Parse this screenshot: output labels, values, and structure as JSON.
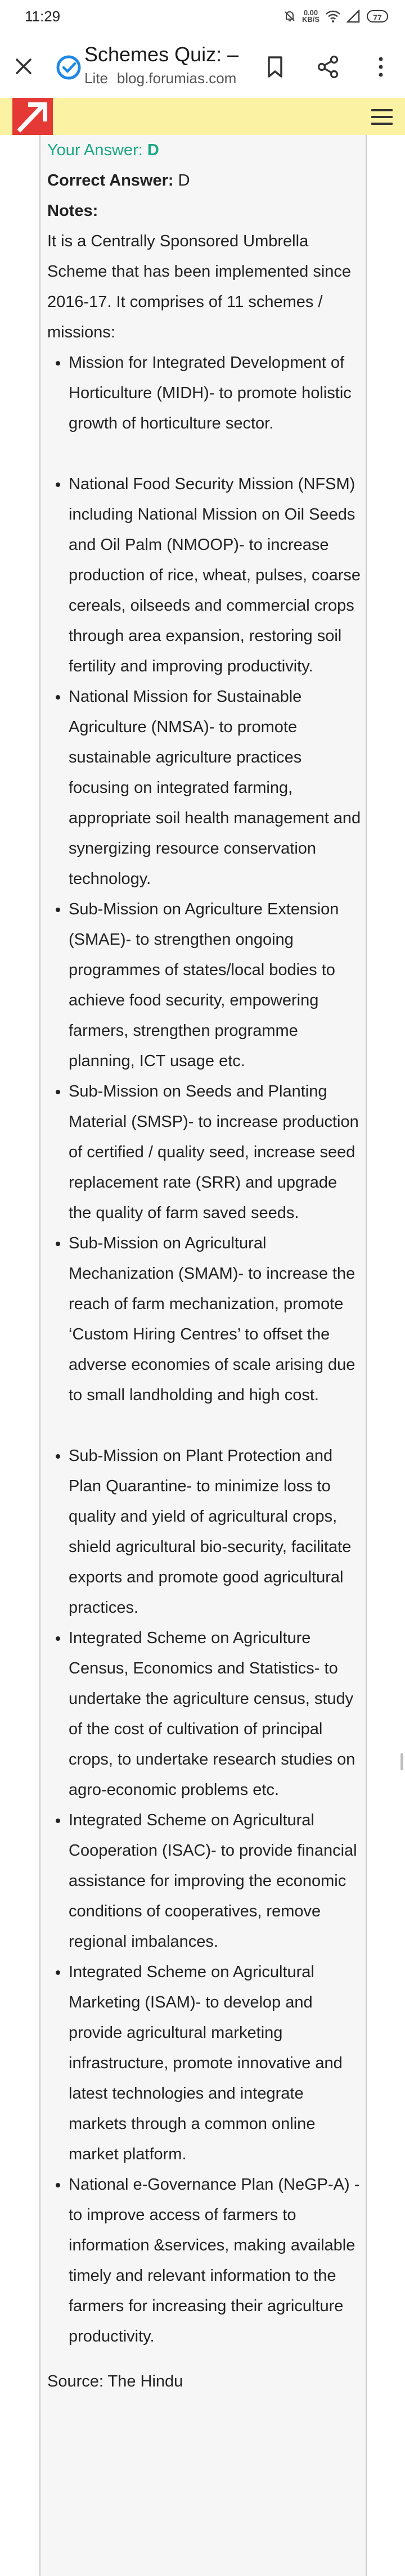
{
  "status_bar": {
    "time": "11:29",
    "speed_value": "0.00",
    "speed_unit": "KB/S",
    "battery": "77"
  },
  "toolbar": {
    "page_title": "Schemes Quiz: – ...",
    "lite_label": "Lite",
    "domain": "blog.forumias.com"
  },
  "colors": {
    "header_bg": "#fbf3a3",
    "logo_bg": "#e53935",
    "answer_green": "#1aa882",
    "card_bg": "#f6f6f6"
  },
  "quiz": {
    "your_answer_label": "Your Answer:",
    "your_answer_value": "D",
    "correct_answer_label": "Correct Answer:",
    "correct_answer_value": "D",
    "notes_label": "Notes:",
    "intro": "It is a Centrally Sponsored Umbrella Scheme that has been implemented since 2016-17. It comprises of 11 schemes / missions:",
    "missions": [
      "Mission for Integrated Development of Horticulture (MIDH)- to promote holistic growth of horticulture sector.",
      "National Food Security Mission (NFSM) including National Mission on Oil Seeds and Oil Palm (NMOOP)- to increase production of rice, wheat, pulses, coarse cereals, oilseeds and commercial crops through area expansion, restoring soil fertility and improving productivity.",
      "National Mission for Sustainable Agriculture (NMSA)- to promote sustainable agriculture practices focusing on integrated farming, appropriate soil health management and synergizing resource conservation technology.",
      "Sub-Mission on Agriculture Extension (SMAE)- to strengthen ongoing programmes of states/local bodies to achieve food security, empowering farmers, strengthen programme planning, ICT usage etc.",
      "Sub-Mission on Seeds and Planting Material (SMSP)- to increase production of certified / quality seed, increase seed replacement rate (SRR) and upgrade the quality of farm saved seeds.",
      "Sub-Mission on Agricultural Mechanization (SMAM)- to increase the reach of farm mechanization, promote ‘Custom Hiring Centres’ to offset the adverse economies of scale arising due to small landholding and high cost.",
      "Sub-Mission on Plant Protection and Plan Quarantine- to minimize loss to quality and yield of agricultural crops, shield agricultural bio-security, facilitate exports and promote good agricultural practices.",
      "Integrated Scheme on Agriculture Census, Economics and Statistics- to undertake the agriculture census, study of the cost of cultivation of principal crops, to undertake research studies on agro-economic problems etc.",
      "Integrated Scheme on Agricultural Cooperation (ISAC)- to provide financial assistance for improving the economic conditions of cooperatives, remove regional imbalances.",
      "Integrated Scheme on Agricultural Marketing (ISAM)- to develop and provide agricultural marketing infrastructure, promote innovative and latest technologies and integrate markets through a common online market platform.",
      "National e-Governance Plan (NeGP-A) - to improve access of farmers to information &services, making available timely and relevant information to the farmers for increasing their agriculture productivity."
    ],
    "source": "Source: The Hindu"
  }
}
